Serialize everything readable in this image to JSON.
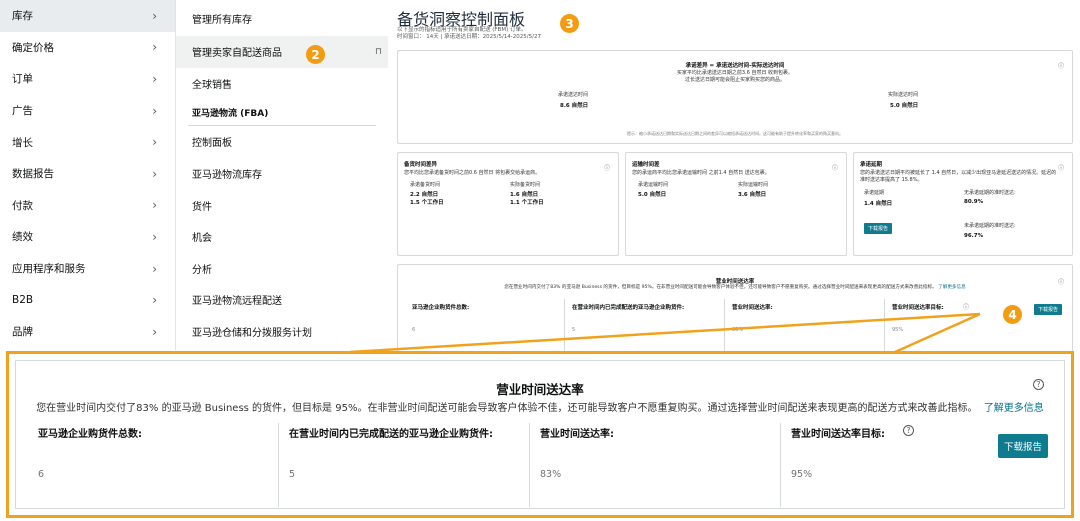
{
  "menu1": {
    "items": [
      {
        "label": "库存"
      },
      {
        "label": "确定价格"
      },
      {
        "label": "订单"
      },
      {
        "label": "广告"
      },
      {
        "label": "增长"
      },
      {
        "label": "数据报告"
      },
      {
        "label": "付款"
      },
      {
        "label": "绩效"
      },
      {
        "label": "应用程序和服务"
      },
      {
        "label": "B2B"
      },
      {
        "label": "品牌"
      }
    ]
  },
  "menu2": {
    "items": [
      {
        "label": "管理所有库存"
      },
      {
        "label": "管理卖家自配送商品"
      },
      {
        "label": "全球销售"
      }
    ],
    "fba_header": "亚马逊物流 (FBA)",
    "fba_items": [
      {
        "label": "控制面板"
      },
      {
        "label": "亚马逊物流库存"
      },
      {
        "label": "货件"
      },
      {
        "label": "机会"
      },
      {
        "label": "分析"
      },
      {
        "label": "亚马逊物流远程配送"
      },
      {
        "label": "亚马逊仓储和分拨服务计划"
      }
    ]
  },
  "badges": {
    "b2": "2",
    "b3": "3",
    "b4": "4"
  },
  "dash": {
    "title": "备货洞察控制面板",
    "sub1": "以下显示的指标适用于所有卖家自配送 (FBM) 订单。",
    "sub2": "时间窗口： 14天 | 承诺送达日期：2025/5/14-2025/5/27",
    "promise": {
      "title": "承诺差异 = 承诺送达时间-实际送达时间",
      "l1": "买家平均比承诺送达日期之前3.6 自然日 收到包裹。",
      "l2": "过长送达日期可能会阻止买家购买您的商品。",
      "left_label": "承诺送达时间",
      "left_val": "8.6 自然日",
      "right_label": "实际送达时间",
      "right_val": "5.0 自然日",
      "footer": "提示：缩小承诺送达日期和实际送达日期之间的差异可以缩短承诺送达时间。这可能有助于提升转化率和买家的购买意向。"
    },
    "handling": {
      "title": "备货时间差异",
      "l1": "您平均比您承诺备货时间之前0.6 自然日 将包裹交给承运商。",
      "a_label": "承诺备货时间",
      "a1": "2.2 自然日",
      "a2": "1.5 个工作日",
      "b_label": "实际备货时间",
      "b1": "1.6 自然日",
      "b2": "1.1 个工作日"
    },
    "transit": {
      "title": "运输时间差",
      "l1": "您的承运商平均比您承诺运输时间 之前1.4 自然日 送达包裹。",
      "a_label": "承诺运输时间",
      "a1": "5.0 自然日",
      "b_label": "实际运输时间",
      "b1": "3.6 自然日"
    },
    "extended": {
      "title": "承诺延期",
      "l1": "您的承诺送达日期平均被延长了 1.4 自然日，以减少出现亚马逊延迟送达的情况。延迟的准时送达率提高了 15.8%。",
      "a_label": "承诺延期",
      "a1": "1.4 自然日",
      "b_label": "无承诺延期的准时送达:",
      "b1": "80.9%",
      "c_label": "未承诺延期的准时送达:",
      "c1": "96.7%",
      "btn": "下载报告"
    },
    "business_small": {
      "title": "营业时间送达率",
      "desc": "您在营业时间内交付了83% 的亚马逊 Business 的货件，但目标是 95%。在非营业时间配送可能会导致客户体验不佳，还可能导致客户不愿重复购买。通过选择营业时间配送来表现更高的配送方式来改善此指标。",
      "link": "了解更多信息",
      "c1": "亚马逊企业购货件总数:",
      "c2": "在营业时间内已完成配送的亚马逊企业购货件:",
      "c3": "营业时间送达率:",
      "c4": "营业时间送达率目标:",
      "v1": "6",
      "v2": "5",
      "v3": "83%",
      "v4": "95%",
      "btn": "下载报告"
    }
  },
  "zoom": {
    "title": "营业时间送达率",
    "desc": "您在营业时间内交付了83% 的亚马逊 Business 的货件，但目标是 95%。在非营业时间配送可能会导致客户体验不佳，还可能导致客户不愿重复购买。通过选择营业时间配送来表现更高的配送方式来改善此指标。",
    "link": "了解更多信息",
    "help": "?",
    "cols": [
      {
        "label": "亚马逊企业购货件总数:",
        "value": "6"
      },
      {
        "label": "在营业时间内已完成配送的亚马逊企业购货件:",
        "value": "5"
      },
      {
        "label": "营业时间送达率:",
        "value": "83%"
      },
      {
        "label": "营业时间送达率目标:",
        "value": "95%"
      }
    ],
    "btn": "下载报告"
  },
  "colors": {
    "accent": "#f0a21c",
    "teal": "#0f7b8f",
    "link": "#007185"
  }
}
